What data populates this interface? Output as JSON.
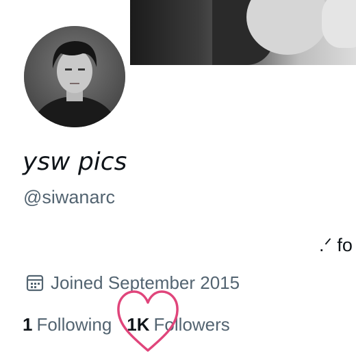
{
  "profile": {
    "display_name": "ysw pics",
    "handle": "@siwanarc",
    "bio": ".ᐟ fo",
    "joined": "Joined September 2015"
  },
  "stats": {
    "following_count": "1",
    "following_label": "Following",
    "followers_count": "1K",
    "followers_label": "Followers"
  },
  "icons": {
    "joined": "calendar-icon",
    "annotation": "heart-outline-icon"
  },
  "colors": {
    "text_primary": "#0f1419",
    "text_secondary": "#536471",
    "heart": "#e0457b"
  }
}
